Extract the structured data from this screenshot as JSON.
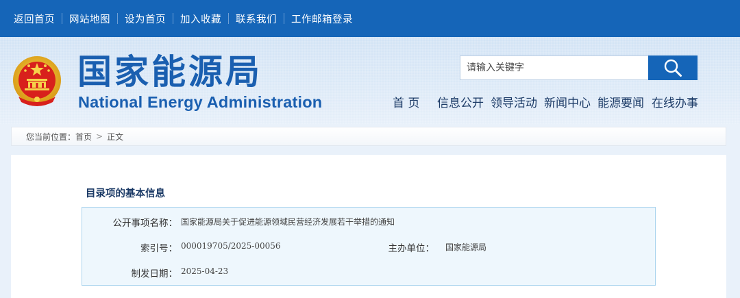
{
  "topbar": {
    "links": [
      "返回首页",
      "网站地图",
      "设为首页",
      "加入收藏",
      "联系我们",
      "工作邮箱登录"
    ]
  },
  "header": {
    "brand_cn": "国家能源局",
    "brand_en": "National Energy Administration",
    "search": {
      "placeholder": "请输入关键字",
      "icon": "search-icon"
    },
    "nav": [
      "首 页",
      "信息公开",
      "领导活动",
      "新闻中心",
      "能源要闻",
      "在线办事"
    ]
  },
  "breadcrumb": {
    "prefix": "您当前位置：",
    "home": "首页",
    "separator": ">",
    "current": "正文"
  },
  "content": {
    "section_title": "目录项的基本信息",
    "fields": {
      "name_label": "公开事项名称：",
      "name_value": "国家能源局关于促进能源领域民营经济发展若干举措的通知",
      "index_label": "索引号：",
      "index_value": "000019705/2025-00056",
      "org_label": "主办单位：",
      "org_value": "国家能源局",
      "date_label": "制发日期：",
      "date_value": "2025-04-23"
    }
  },
  "colors": {
    "topbar": "#1565b8",
    "brand": "#1a5fb0",
    "nav_text": "#1b3a66",
    "info_bg": "#eef7fd",
    "info_border": "#a9d3ee"
  }
}
